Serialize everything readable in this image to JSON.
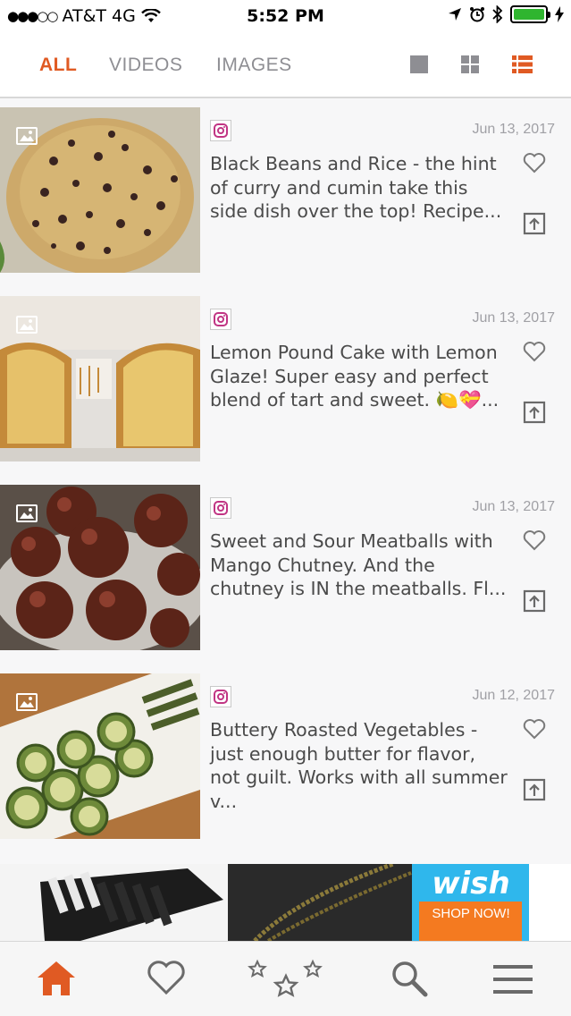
{
  "status": {
    "carrier": "AT&T 4G",
    "time": "5:52 PM"
  },
  "tabs": [
    {
      "label": "ALL",
      "active": true
    },
    {
      "label": "VIDEOS",
      "active": false
    },
    {
      "label": "IMAGES",
      "active": false
    }
  ],
  "view_modes": [
    "single-view-icon",
    "grid-view-icon",
    "list-view-icon"
  ],
  "colors": {
    "accent": "#e05a23",
    "muted": "#8e8e93",
    "instagram": "#c13584",
    "wish_blue": "#2fb7ec",
    "wish_orange": "#f47a20"
  },
  "posts": [
    {
      "date": "Jun 13, 2017",
      "caption": "Black Beans and Rice - the hint of curry and cumin take this side dish over the top! Recipe..."
    },
    {
      "date": "Jun 13, 2017",
      "caption": "Lemon Pound Cake with Lemon Glaze! Super easy and perfect blend of tart and sweet. 🍋💝..."
    },
    {
      "date": "Jun 13, 2017",
      "caption": "Sweet and Sour Meatballs with Mango Chutney. And the chutney is IN the meatballs. Fl..."
    },
    {
      "date": "Jun 12, 2017",
      "caption": "Buttery Roasted Vegetables - just enough butter for flavor, not guilt. Works with all summer v..."
    }
  ],
  "ad": {
    "brand": "wish",
    "cta": "SHOP NOW!"
  },
  "bottom_nav": [
    "home-icon",
    "heart-icon",
    "stars-icon",
    "search-icon",
    "menu-icon"
  ]
}
